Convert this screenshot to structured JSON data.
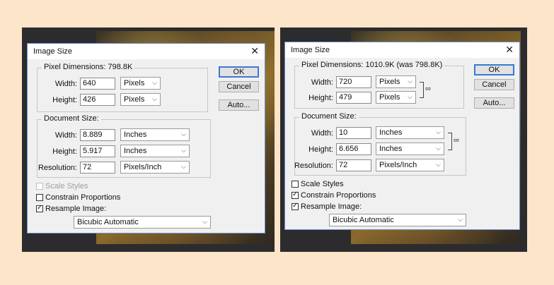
{
  "left_dialog": {
    "title": "Image Size",
    "pixel_dimensions": {
      "legend": "Pixel Dimensions:",
      "size": "798.8K",
      "width_label": "Width:",
      "width_value": "640",
      "width_unit": "Pixels",
      "height_label": "Height:",
      "height_value": "426",
      "height_unit": "Pixels"
    },
    "document_size": {
      "legend": "Document Size:",
      "width_label": "Width:",
      "width_value": "8.889",
      "width_unit": "Inches",
      "height_label": "Height:",
      "height_value": "5.917",
      "height_unit": "Inches",
      "resolution_label": "Resolution:",
      "resolution_value": "72",
      "resolution_unit": "Pixels/Inch"
    },
    "buttons": {
      "ok": "OK",
      "cancel": "Cancel",
      "auto": "Auto..."
    },
    "checkboxes": {
      "scale_styles": "Scale Styles",
      "constrain": "Constrain Proportions",
      "resample": "Resample Image:"
    },
    "resample_method": "Bicubic Automatic"
  },
  "right_dialog": {
    "title": "Image Size",
    "pixel_dimensions": {
      "legend": "Pixel Dimensions:",
      "size": "1010.9K (was 798.8K)",
      "width_label": "Width:",
      "width_value": "720",
      "width_unit": "Pixels",
      "height_label": "Height:",
      "height_value": "479",
      "height_unit": "Pixels"
    },
    "document_size": {
      "legend": "Document Size:",
      "width_label": "Width:",
      "width_value": "10",
      "width_unit": "Inches",
      "height_label": "Height:",
      "height_value": "6.656",
      "height_unit": "Inches",
      "resolution_label": "Resolution:",
      "resolution_value": "72",
      "resolution_unit": "Pixels/Inch"
    },
    "buttons": {
      "ok": "OK",
      "cancel": "Cancel",
      "auto": "Auto..."
    },
    "checkboxes": {
      "scale_styles": "Scale Styles",
      "constrain": "Constrain Proportions",
      "resample": "Resample Image:"
    },
    "resample_method": "Bicubic Automatic"
  }
}
